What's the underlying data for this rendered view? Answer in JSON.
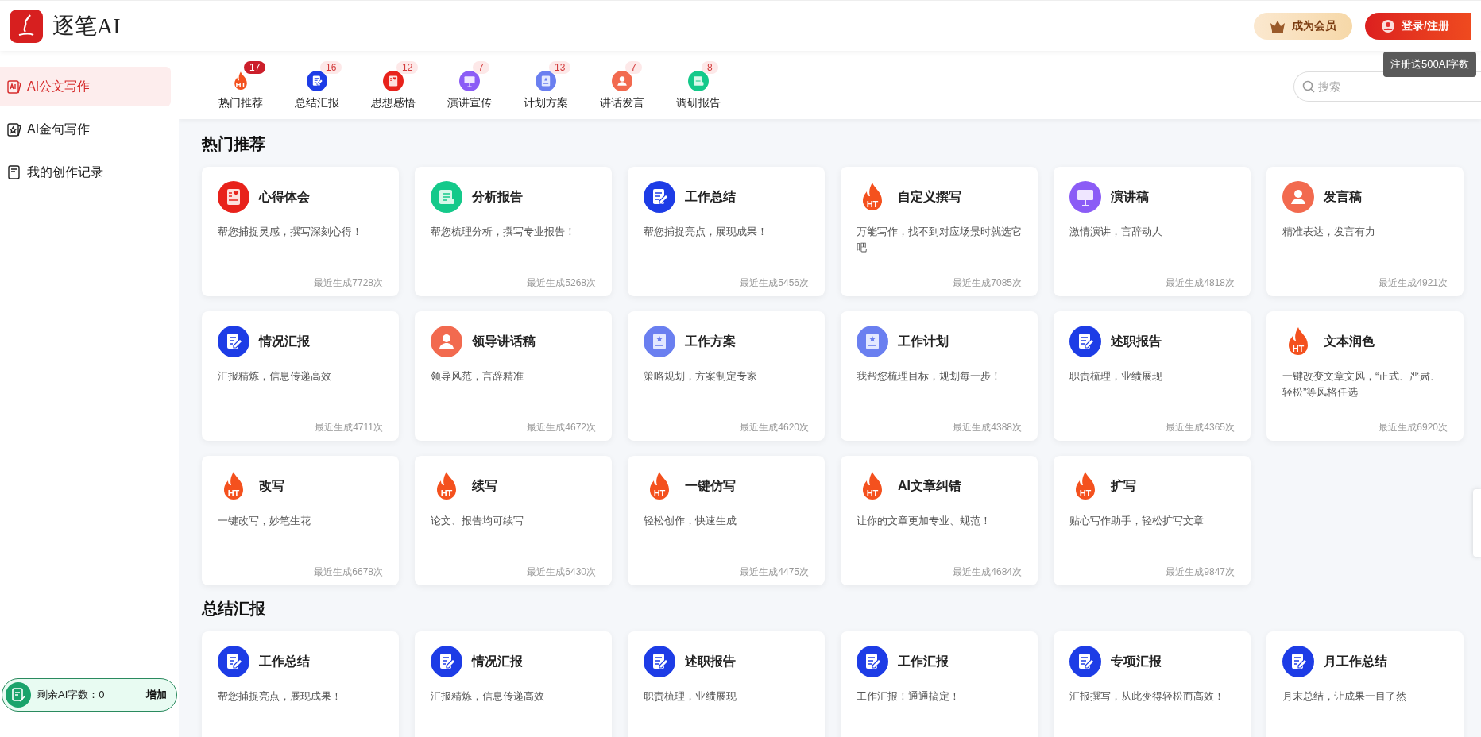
{
  "header": {
    "logo_text": "逐笔AI",
    "member_button": "成为会员",
    "login_button": "登录/注册",
    "tooltip": "注册送500AI字数"
  },
  "sidebar": {
    "items": [
      {
        "label": "AI公文写作",
        "kind": "ai-card",
        "selected": true
      },
      {
        "label": "AI金句写作",
        "kind": "star-card",
        "selected": false
      },
      {
        "label": "我的创作记录",
        "kind": "notebook",
        "selected": false
      }
    ],
    "quota": {
      "label": "剩余AI字数：0",
      "action": "增加"
    }
  },
  "tabs": [
    {
      "label": "热门推荐",
      "count": "17",
      "kind": "flame",
      "icon_label": "HT",
      "selected": true
    },
    {
      "label": "总结汇报",
      "count": "16",
      "kind": "pen",
      "selected": false
    },
    {
      "label": "思想感悟",
      "count": "12",
      "kind": "heart-doc",
      "selected": false
    },
    {
      "label": "演讲宣传",
      "count": "7",
      "kind": "easel",
      "selected": false
    },
    {
      "label": "计划方案",
      "count": "13",
      "kind": "book",
      "selected": false
    },
    {
      "label": "讲话发言",
      "count": "7",
      "kind": "person",
      "selected": false
    },
    {
      "label": "调研报告",
      "count": "8",
      "kind": "scroll",
      "selected": false
    }
  ],
  "search": {
    "placeholder": "搜索"
  },
  "sections": [
    {
      "title": "热门推荐",
      "cards": [
        {
          "title": "心得体会",
          "desc": "帮您捕捉灵感，撰写深刻心得！",
          "count": "最近生成7728次",
          "kind": "heart-doc"
        },
        {
          "title": "分析报告",
          "desc": "帮您梳理分析，撰写专业报告！",
          "count": "最近生成5268次",
          "kind": "scroll"
        },
        {
          "title": "工作总结",
          "desc": "帮您捕捉亮点，展现成果！",
          "count": "最近生成5456次",
          "kind": "pen"
        },
        {
          "title": "自定义撰写",
          "desc": "万能写作，找不到对应场景时就选它吧",
          "count": "最近生成7085次",
          "kind": "flame",
          "icon_label": "HT"
        },
        {
          "title": "演讲稿",
          "desc": "激情演讲，言辞动人",
          "count": "最近生成4818次",
          "kind": "easel"
        },
        {
          "title": "发言稿",
          "desc": "精准表达，发言有力",
          "count": "最近生成4921次",
          "kind": "person"
        },
        {
          "title": "情况汇报",
          "desc": "汇报精炼，信息传递高效",
          "count": "最近生成4711次",
          "kind": "pen"
        },
        {
          "title": "领导讲话稿",
          "desc": "领导风范，言辞精准",
          "count": "最近生成4672次",
          "kind": "person"
        },
        {
          "title": "工作方案",
          "desc": "策略规划，方案制定专家",
          "count": "最近生成4620次",
          "kind": "book"
        },
        {
          "title": "工作计划",
          "desc": "我帮您梳理目标，规划每一步！",
          "count": "最近生成4388次",
          "kind": "book"
        },
        {
          "title": "述职报告",
          "desc": "职责梳理，业绩展现",
          "count": "最近生成4365次",
          "kind": "pen"
        },
        {
          "title": "文本润色",
          "desc": "一键改变文章文风，“正式、严肃、轻松”等风格任选",
          "count": "最近生成6920次",
          "kind": "flame",
          "icon_label": "HT"
        },
        {
          "title": "改写",
          "desc": "一键改写，妙笔生花",
          "count": "最近生成6678次",
          "kind": "flame",
          "icon_label": "HT"
        },
        {
          "title": "续写",
          "desc": "论文、报告均可续写",
          "count": "最近生成6430次",
          "kind": "flame",
          "icon_label": "HT"
        },
        {
          "title": "一键仿写",
          "desc": "轻松创作，快速生成",
          "count": "最近生成4475次",
          "kind": "flame",
          "icon_label": "HT"
        },
        {
          "title": "AI文章纠错",
          "desc": "让你的文章更加专业、规范！",
          "count": "最近生成4684次",
          "kind": "flame",
          "icon_label": "HT"
        },
        {
          "title": "扩写",
          "desc": "贴心写作助手，轻松扩写文章",
          "count": "最近生成9847次",
          "kind": "flame",
          "icon_label": "HT"
        }
      ]
    },
    {
      "title": "总结汇报",
      "cards": [
        {
          "title": "工作总结",
          "desc": "帮您捕捉亮点，展现成果！",
          "kind": "pen"
        },
        {
          "title": "情况汇报",
          "desc": "汇报精炼，信息传递高效",
          "kind": "pen"
        },
        {
          "title": "述职报告",
          "desc": "职责梳理，业绩展现",
          "kind": "pen"
        },
        {
          "title": "工作汇报",
          "desc": "工作汇报！通通搞定！",
          "kind": "pen"
        },
        {
          "title": "专项汇报",
          "desc": "汇报撰写，从此变得轻松而高效！",
          "kind": "pen"
        },
        {
          "title": "月工作总结",
          "desc": "月末总结，让成果一目了然",
          "kind": "pen"
        }
      ]
    }
  ]
}
